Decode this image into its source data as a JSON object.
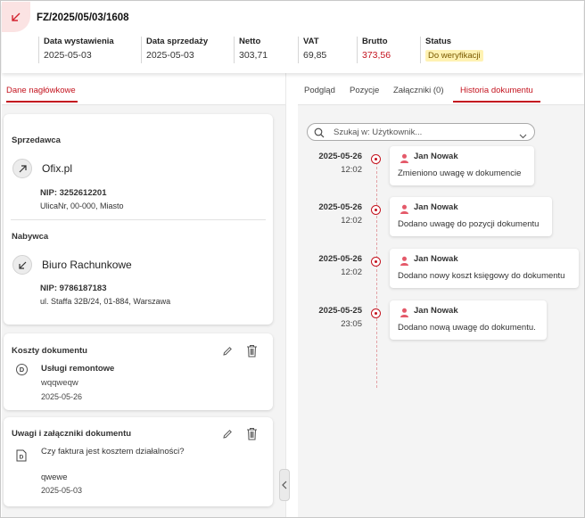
{
  "header": {
    "doc_icon": "arrow-down-left-icon",
    "doc_number": "FZ/2025/05/03/1608",
    "fields": [
      {
        "label": "Data wystawienia",
        "value": "2025-05-03"
      },
      {
        "label": "Data sprzedaży",
        "value": "2025-05-03"
      },
      {
        "label": "Netto",
        "value": "303,71"
      },
      {
        "label": "VAT",
        "value": "69,85"
      },
      {
        "label": "Brutto",
        "value": "373,56"
      },
      {
        "label": "Status",
        "value": "Do weryfikacji"
      }
    ],
    "brutto_color": "#c4141f"
  },
  "left": {
    "tab": "Dane nagłówkowe",
    "seller": {
      "section": "Sprzedawca",
      "name": "Ofix.pl",
      "nip": "NIP: 3252612201",
      "address": "UlicaNr, 00-000, Miasto",
      "icon": "arrow-up-right-icon"
    },
    "buyer": {
      "section": "Nabywca",
      "name": "Biuro Rachunkowe",
      "nip": "NIP: 9786187183",
      "address": "ul. Staffa 32B/24, 01-884, Warszawa",
      "icon": "arrow-down-left-icon"
    },
    "costs": {
      "title": "Koszty dokumentu",
      "item_badge": "D",
      "item_name": "Usługi remontowe",
      "item_desc": "wqqweqw",
      "item_date": "2025-05-26"
    },
    "notes": {
      "title": "Uwagi i załączniki dokumentu",
      "question": "Czy faktura jest kosztem działalności?",
      "answer": "qwewe",
      "date": "2025-05-03"
    }
  },
  "right": {
    "tabs": [
      "Podgląd",
      "Pozycje",
      "Załączniki (0)",
      "Historia dokumentu"
    ],
    "active_tab": "Historia dokumentu",
    "search_placeholder": "Szukaj w: Użytkownik...",
    "history": [
      {
        "date": "2025-05-26",
        "time": "12:02",
        "user": "Jan Nowak",
        "text": "Zmieniono uwagę w dokumencie"
      },
      {
        "date": "2025-05-26",
        "time": "12:02",
        "user": "Jan Nowak",
        "text": "Dodano uwagę do pozycji dokumentu"
      },
      {
        "date": "2025-05-26",
        "time": "12:02",
        "user": "Jan Nowak",
        "text": "Dodano nowy koszt księgowy do dokumentu"
      },
      {
        "date": "2025-05-25",
        "time": "23:05",
        "user": "Jan Nowak",
        "text": "Dodano nową uwagę do dokumentu."
      }
    ]
  },
  "colors": {
    "accent": "#c4141f",
    "status_bg": "#fff2b3"
  }
}
